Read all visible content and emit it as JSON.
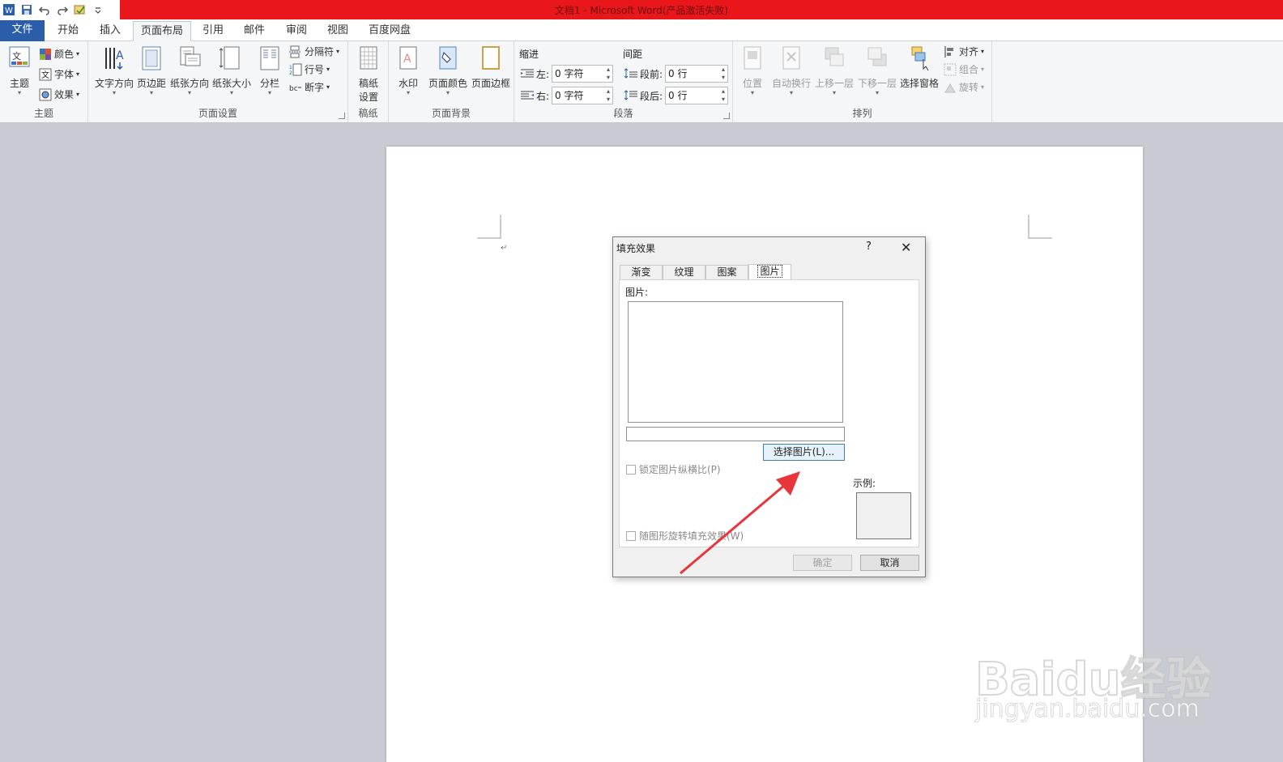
{
  "window": {
    "title": "文档1 - Microsoft Word(产品激活失败)"
  },
  "tabs": [
    {
      "label": "文件"
    },
    {
      "label": "开始"
    },
    {
      "label": "插入"
    },
    {
      "label": "页面布局"
    },
    {
      "label": "引用"
    },
    {
      "label": "邮件"
    },
    {
      "label": "审阅"
    },
    {
      "label": "视图"
    },
    {
      "label": "百度网盘"
    }
  ],
  "ribbon": {
    "theme": {
      "label": "主题",
      "themes": "主题",
      "colors": "颜色",
      "fonts": "字体",
      "effects": "效果"
    },
    "page_setup": {
      "label": "页面设置",
      "text_direction": "文字方向",
      "margins": "页边距",
      "orientation": "纸张方向",
      "size": "纸张大小",
      "columns": "分栏",
      "breaks": "分隔符",
      "line_numbers": "行号",
      "hyphenation": "断字"
    },
    "manuscript": {
      "label": "稿纸",
      "setup_line1": "稿纸",
      "setup_line2": "设置"
    },
    "page_background": {
      "label": "页面背景",
      "watermark": "水印",
      "page_color": "页面颜色",
      "page_borders": "页面边框"
    },
    "paragraph": {
      "label": "段落",
      "indent_title": "缩进",
      "spacing_title": "间距",
      "left_label": "左:",
      "right_label": "右:",
      "before_label": "段前:",
      "after_label": "段后:",
      "left_value": "0 字符",
      "right_value": "0 字符",
      "before_value": "0 行",
      "after_value": "0 行"
    },
    "arrange": {
      "label": "排列",
      "position": "位置",
      "wrap_text": "自动换行",
      "bring_forward": "上移一层",
      "send_backward": "下移一层",
      "selection_pane": "选择窗格",
      "align": "对齐",
      "group": "组合",
      "rotate": "旋转"
    }
  },
  "dialog": {
    "title": "填充效果",
    "help": "?",
    "tabs": [
      {
        "label": "渐变"
      },
      {
        "label": "纹理"
      },
      {
        "label": "图案"
      },
      {
        "label": "图片"
      }
    ],
    "picture_label": "图片:",
    "select_picture_button": "选择图片(L)...",
    "lock_aspect_label": "锁定图片纵横比(P)",
    "rotate_with_shape_label": "随图形旋转填充效果(W)",
    "sample_label": "示例:",
    "ok": "确定",
    "cancel": "取消"
  },
  "watermark": {
    "brand": "Baidu经验",
    "url": "jingyan.baidu.com"
  },
  "colors": {
    "title_bar_red": "#e9161b",
    "file_tab_blue": "#2a5daa",
    "annotation_arrow": "#e8353a"
  }
}
